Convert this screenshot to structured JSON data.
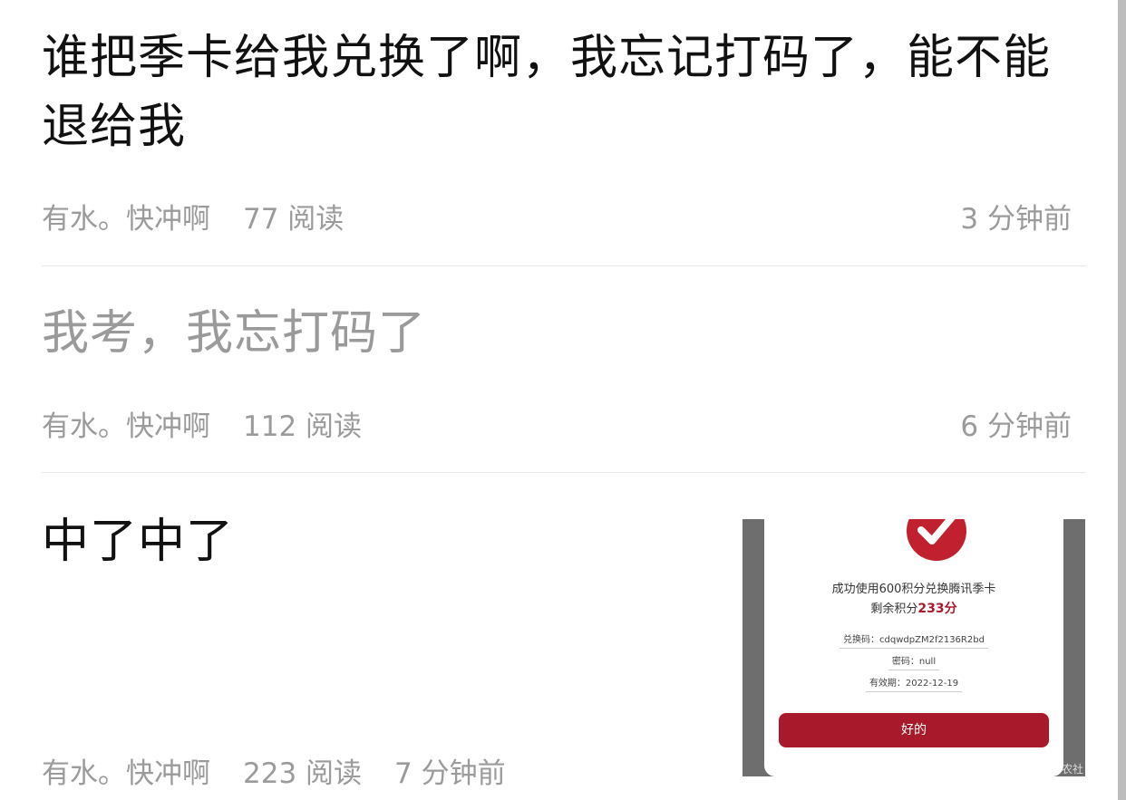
{
  "feed": {
    "items": [
      {
        "title": "谁把季卡给我兑换了啊，我忘记打码了，能不能退给我",
        "author": "有水。快冲啊",
        "reads": "77 阅读",
        "time": "3 分钟前"
      },
      {
        "title": "我考，我忘打码了",
        "author": "有水。快冲啊",
        "reads": "112 阅读",
        "time": "6 分钟前"
      },
      {
        "title": "中了中了",
        "author": "有水。快冲啊",
        "reads": "223 阅读",
        "time": "7 分钟前",
        "thumbnail": {
          "success_text": "成功使用600积分兑换腾讯季卡",
          "remaining_label": "剩余积分",
          "remaining_value": "233分",
          "code_label": "兑换码：cdqwdpZM2f2136R2bd",
          "password_label": "密码：null",
          "expiry_label": "有效期：2022-12-19",
          "ok_button": "好的",
          "watermark": "农社"
        }
      }
    ]
  },
  "colors": {
    "title": "#111111",
    "title_read": "#9a9a9a",
    "meta": "#9b9b9b",
    "divider": "#e6e6e6",
    "accent": "#a8192b"
  }
}
